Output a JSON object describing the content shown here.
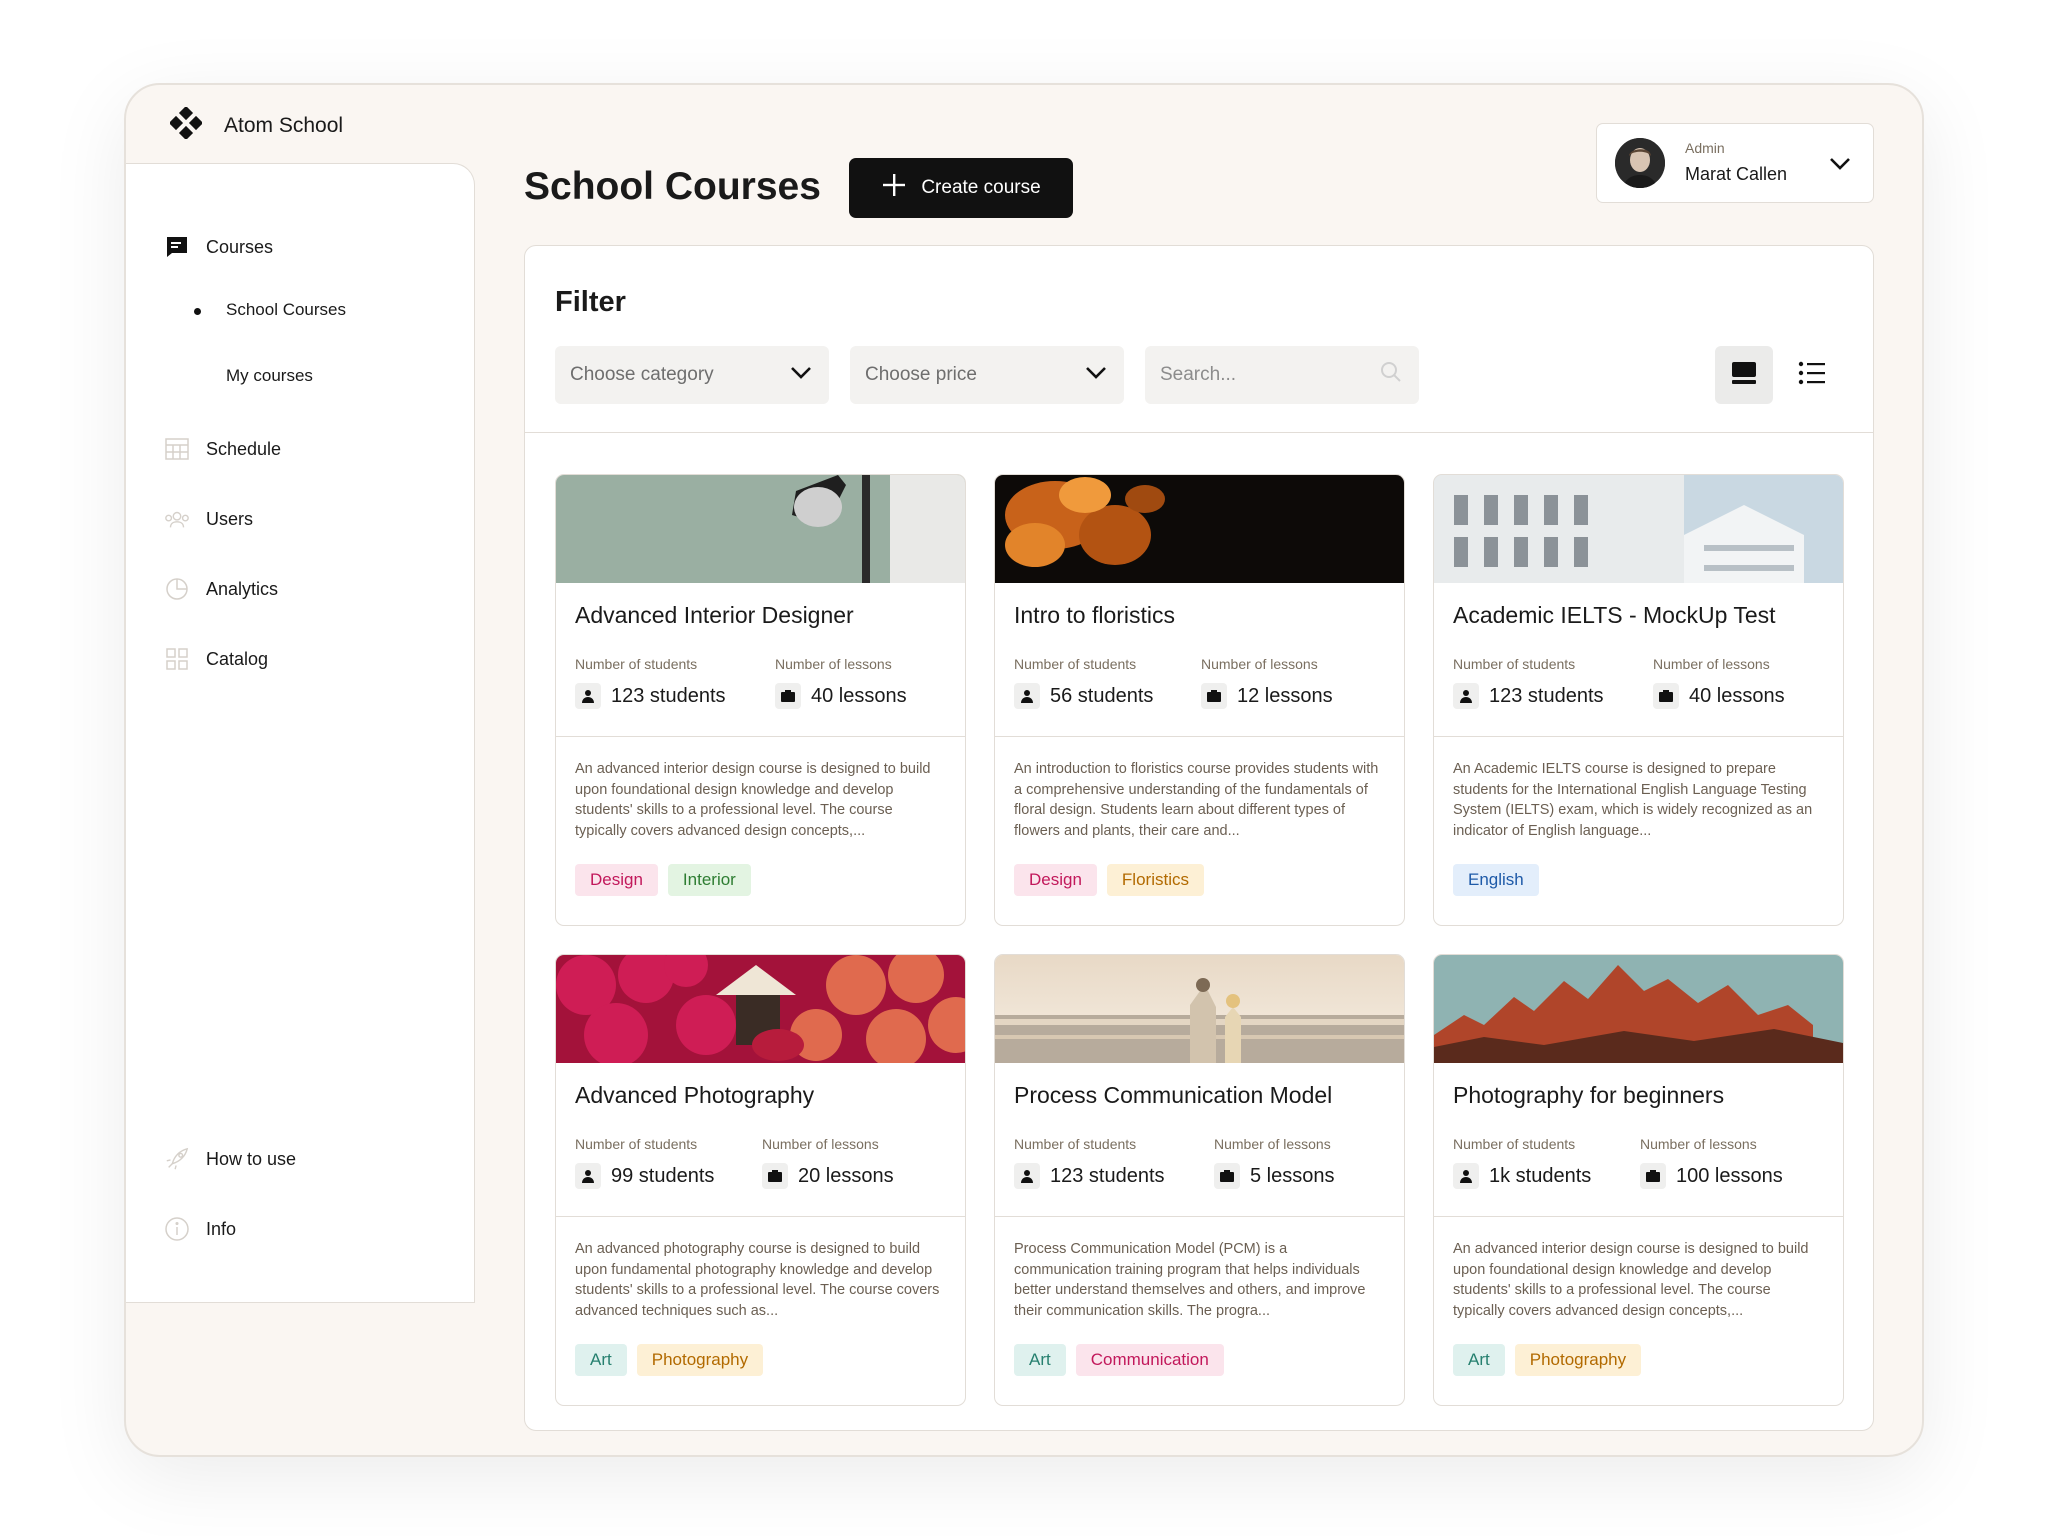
{
  "brand": {
    "name": "Atom School"
  },
  "sidebar": {
    "main": [
      {
        "label": "Courses",
        "icon": "chat-bubble-icon"
      },
      {
        "label": "Schedule",
        "icon": "calendar-icon"
      },
      {
        "label": "Users",
        "icon": "users-icon"
      },
      {
        "label": "Analytics",
        "icon": "pie-chart-icon"
      },
      {
        "label": "Catalog",
        "icon": "grid-icon"
      }
    ],
    "sub": [
      {
        "label": "School Courses",
        "active": true
      },
      {
        "label": "My courses",
        "active": false
      }
    ],
    "bottom": [
      {
        "label": "How to use",
        "icon": "rocket-icon"
      },
      {
        "label": "Info",
        "icon": "info-icon"
      }
    ]
  },
  "header": {
    "title": "School Courses",
    "create_label": "Create course"
  },
  "user": {
    "role": "Admin",
    "name": "Marat Callen"
  },
  "filter": {
    "title": "Filter",
    "category_placeholder": "Choose category",
    "price_placeholder": "Choose price",
    "search_placeholder": "Search..."
  },
  "labels": {
    "students": "Number of students",
    "lessons": "Number of lessons"
  },
  "courses": [
    {
      "title": "Advanced Interior Designer",
      "students": "123 students",
      "lessons": "40 lessons",
      "description": "An advanced interior design course is designed to build upon foundational design knowledge and develop students' skills to a professional level. The course typically covers advanced design concepts,...",
      "tags": [
        {
          "label": "Design",
          "color": "#c2185b",
          "bg": "#fbe4ec"
        },
        {
          "label": "Interior",
          "color": "#2e7d32",
          "bg": "#e3f4e2"
        }
      ]
    },
    {
      "title": "Intro to floristics",
      "students": "56 students",
      "lessons": "12 lessons",
      "description": "An introduction to floristics course provides students with a comprehensive understanding of the fundamentals of floral design. Students learn about different types of flowers and plants, their care and...",
      "tags": [
        {
          "label": "Design",
          "color": "#c2185b",
          "bg": "#fbe4ec"
        },
        {
          "label": "Floristics",
          "color": "#b26a00",
          "bg": "#fdf0d5"
        }
      ]
    },
    {
      "title": "Academic IELTS - MockUp Test",
      "students": "123 students",
      "lessons": "40 lessons",
      "description": "An Academic IELTS course is designed to prepare students for the International English Language Testing System (IELTS) exam, which is widely recognized as an indicator of English language...",
      "tags": [
        {
          "label": "English",
          "color": "#1e5aa8",
          "bg": "#e3eefb"
        }
      ]
    },
    {
      "title": "Advanced Photography",
      "students": "99 students",
      "lessons": "20 lessons",
      "description": "An advanced photography course is designed to build upon fundamental photography knowledge and develop students' skills to a professional level. The course covers advanced techniques such as...",
      "tags": [
        {
          "label": "Art",
          "color": "#26806f",
          "bg": "#dff1ee"
        },
        {
          "label": "Photography",
          "color": "#b26a00",
          "bg": "#fdf0d5"
        }
      ]
    },
    {
      "title": "Process Communication Model",
      "students": "123 students",
      "lessons": "5 lessons",
      "description": "Process Communication Model (PCM) is a communication training program that helps individuals better understand themselves and others, and improve their communication skills. The progra...",
      "tags": [
        {
          "label": "Art",
          "color": "#26806f",
          "bg": "#dff1ee"
        },
        {
          "label": "Communication",
          "color": "#c2185b",
          "bg": "#fbe4ec"
        }
      ]
    },
    {
      "title": "Photography for beginners",
      "students": "1k students",
      "lessons": "100 lessons",
      "description": "An advanced interior design course is designed to build upon foundational design knowledge and develop students' skills to a professional level. The course typically covers advanced design concepts,...",
      "tags": [
        {
          "label": "Art",
          "color": "#26806f",
          "bg": "#dff1ee"
        },
        {
          "label": "Photography",
          "color": "#b26a00",
          "bg": "#fdf0d5"
        }
      ]
    }
  ]
}
